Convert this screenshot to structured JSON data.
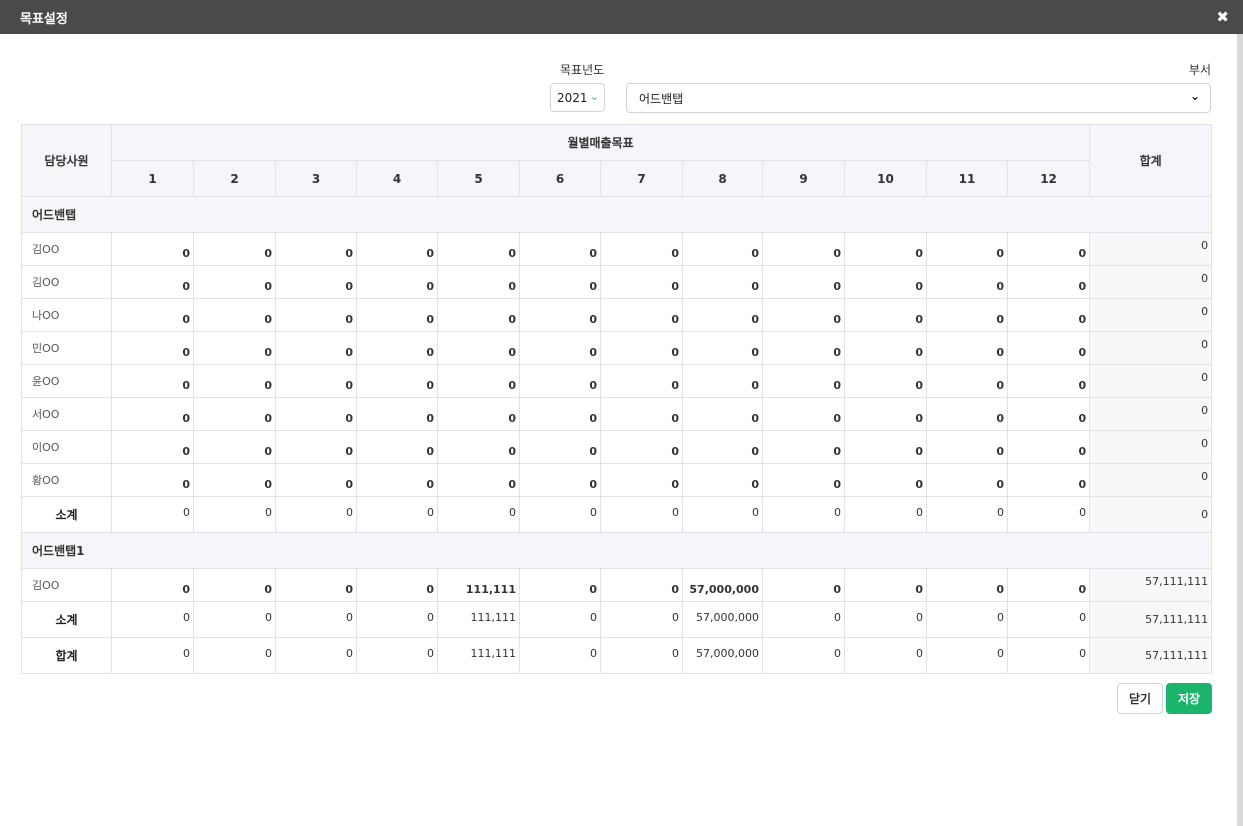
{
  "window": {
    "title": "목표설정"
  },
  "filters": {
    "year_label": "목표년도",
    "year_value": "2021",
    "dept_label": "부서",
    "dept_value": "어드밴탭"
  },
  "table": {
    "col_employee": "담당사원",
    "col_monthly": "월별매출목표",
    "col_total": "합계",
    "months": [
      "1",
      "2",
      "3",
      "4",
      "5",
      "6",
      "7",
      "8",
      "9",
      "10",
      "11",
      "12"
    ],
    "groups": [
      {
        "name": "어드밴탭",
        "rows": [
          {
            "name": "김OO",
            "values": [
              "0",
              "0",
              "0",
              "0",
              "0",
              "0",
              "0",
              "0",
              "0",
              "0",
              "0",
              "0"
            ],
            "total": "0"
          },
          {
            "name": "김OO",
            "values": [
              "0",
              "0",
              "0",
              "0",
              "0",
              "0",
              "0",
              "0",
              "0",
              "0",
              "0",
              "0"
            ],
            "total": "0"
          },
          {
            "name": "나OO",
            "values": [
              "0",
              "0",
              "0",
              "0",
              "0",
              "0",
              "0",
              "0",
              "0",
              "0",
              "0",
              "0"
            ],
            "total": "0"
          },
          {
            "name": "민OO",
            "values": [
              "0",
              "0",
              "0",
              "0",
              "0",
              "0",
              "0",
              "0",
              "0",
              "0",
              "0",
              "0"
            ],
            "total": "0"
          },
          {
            "name": "윤OO",
            "values": [
              "0",
              "0",
              "0",
              "0",
              "0",
              "0",
              "0",
              "0",
              "0",
              "0",
              "0",
              "0"
            ],
            "total": "0"
          },
          {
            "name": "서OO",
            "values": [
              "0",
              "0",
              "0",
              "0",
              "0",
              "0",
              "0",
              "0",
              "0",
              "0",
              "0",
              "0"
            ],
            "total": "0"
          },
          {
            "name": "이OO",
            "values": [
              "0",
              "0",
              "0",
              "0",
              "0",
              "0",
              "0",
              "0",
              "0",
              "0",
              "0",
              "0"
            ],
            "total": "0"
          },
          {
            "name": "황OO",
            "values": [
              "0",
              "0",
              "0",
              "0",
              "0",
              "0",
              "0",
              "0",
              "0",
              "0",
              "0",
              "0"
            ],
            "total": "0"
          }
        ],
        "subtotal": {
          "label": "소계",
          "values": [
            "0",
            "0",
            "0",
            "0",
            "0",
            "0",
            "0",
            "0",
            "0",
            "0",
            "0",
            "0"
          ],
          "total": "0"
        }
      },
      {
        "name": "어드밴탭1",
        "rows": [
          {
            "name": "김OO",
            "values": [
              "0",
              "0",
              "0",
              "0",
              "111,111",
              "0",
              "0",
              "57,000,000",
              "0",
              "0",
              "0",
              "0"
            ],
            "total": "57,111,111"
          }
        ],
        "subtotal": {
          "label": "소계",
          "values": [
            "0",
            "0",
            "0",
            "0",
            "111,111",
            "0",
            "0",
            "57,000,000",
            "0",
            "0",
            "0",
            "0"
          ],
          "total": "57,111,111"
        }
      }
    ],
    "grand_total": {
      "label": "합계",
      "values": [
        "0",
        "0",
        "0",
        "0",
        "111,111",
        "0",
        "0",
        "57,000,000",
        "0",
        "0",
        "0",
        "0"
      ],
      "total": "57,111,111"
    }
  },
  "buttons": {
    "close": "닫기",
    "save": "저장"
  }
}
